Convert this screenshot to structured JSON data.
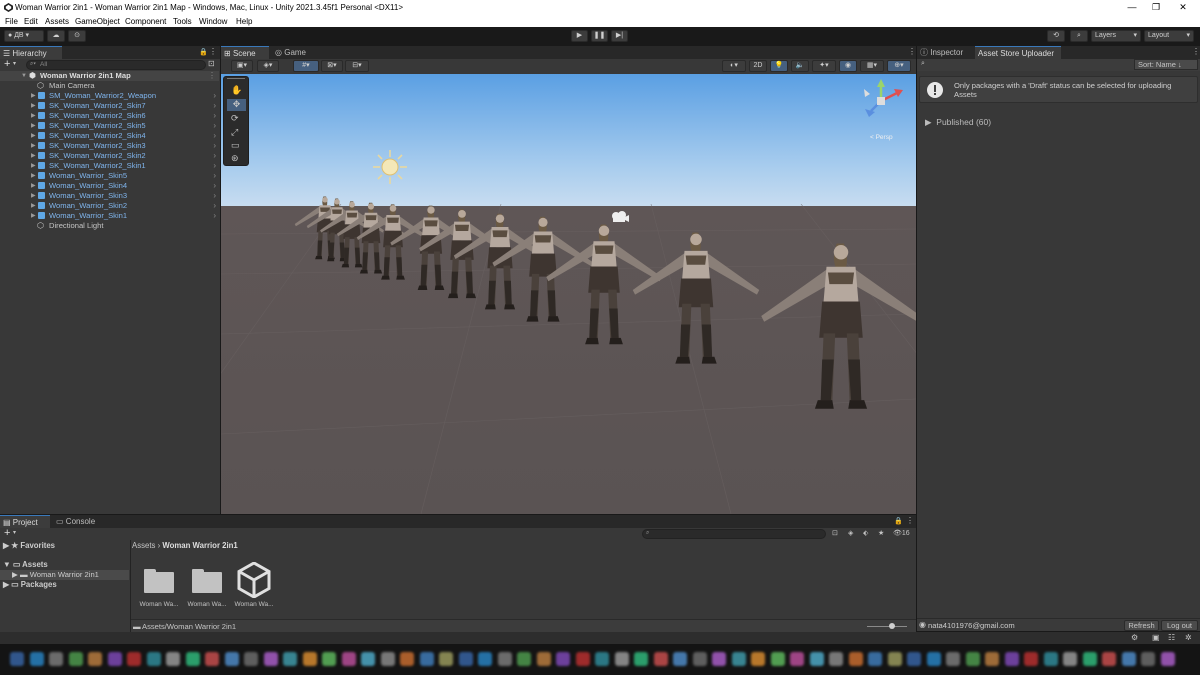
{
  "window": {
    "title": "Woman Warrior 2in1 - Woman Warrior 2in1 Map - Windows, Mac, Linux - Unity 2021.3.45f1 Personal <DX11>",
    "minimize": "—",
    "maximize": "❐",
    "close": "✕"
  },
  "menu": [
    "File",
    "Edit",
    "Assets",
    "GameObject",
    "Component",
    "Tools",
    "Window",
    "Help"
  ],
  "toolbar": {
    "account": "ДВ",
    "layers": "Layers",
    "layout": "Layout"
  },
  "hierarchy": {
    "tab": "Hierarchy",
    "search_placeholder": "All",
    "scene_name": "Woman Warrior 2in1 Map",
    "items": [
      {
        "label": "Main Camera",
        "prefab": false
      },
      {
        "label": "SM_Woman_Warrior2_Weapon",
        "prefab": true
      },
      {
        "label": "SK_Woman_Warrior2_Skin7",
        "prefab": true
      },
      {
        "label": "SK_Woman_Warrior2_Skin6",
        "prefab": true
      },
      {
        "label": "SK_Woman_Warrior2_Skin5",
        "prefab": true
      },
      {
        "label": "SK_Woman_Warrior2_Skin4",
        "prefab": true
      },
      {
        "label": "SK_Woman_Warrior2_Skin3",
        "prefab": true
      },
      {
        "label": "SK_Woman_Warrior2_Skin2",
        "prefab": true
      },
      {
        "label": "SK_Woman_Warrior2_Skin1",
        "prefab": true
      },
      {
        "label": "Woman_Warrior_Skin5",
        "prefab": true
      },
      {
        "label": "Woman_Warrior_Skin4",
        "prefab": true
      },
      {
        "label": "Woman_Warrior_Skin3",
        "prefab": true
      },
      {
        "label": "Woman_Warrior_Skin2",
        "prefab": true
      },
      {
        "label": "Woman_Warrior_Skin1",
        "prefab": true
      },
      {
        "label": "Directional Light",
        "prefab": false
      }
    ]
  },
  "scene_view": {
    "tabs": [
      "Scene",
      "Game"
    ],
    "mode_2d": "2D",
    "gizmo_label": "< Persp"
  },
  "inspector": {
    "tabs": [
      "Inspector",
      "Asset Store Uploader"
    ],
    "sort_label": "Sort: Name ↓",
    "info_message": "Only packages with a 'Draft' status can be selected for uploading Assets",
    "published_label": "Published (60)",
    "account_email": "nata4101976@gmail.com",
    "refresh_button": "Refresh",
    "logout_button": "Log out"
  },
  "project": {
    "tabs": [
      "Project",
      "Console"
    ],
    "favorites": "Favorites",
    "assets": "Assets",
    "assets_child": "Woman Warrior 2in1",
    "packages": "Packages",
    "breadcrumb_root": "Assets",
    "breadcrumb_current": "Woman Warrior 2in1",
    "badge_count": "16",
    "items": [
      "Woman Wa...",
      "Woman Wa...",
      "Woman Wa..."
    ],
    "path": "Assets/Woman Warrior 2in1"
  },
  "colors": {
    "accent": "#3a79bb",
    "prefab_text": "#7fb4ec",
    "sky_top": "#5a9fe3",
    "ground": "#5d5555"
  }
}
